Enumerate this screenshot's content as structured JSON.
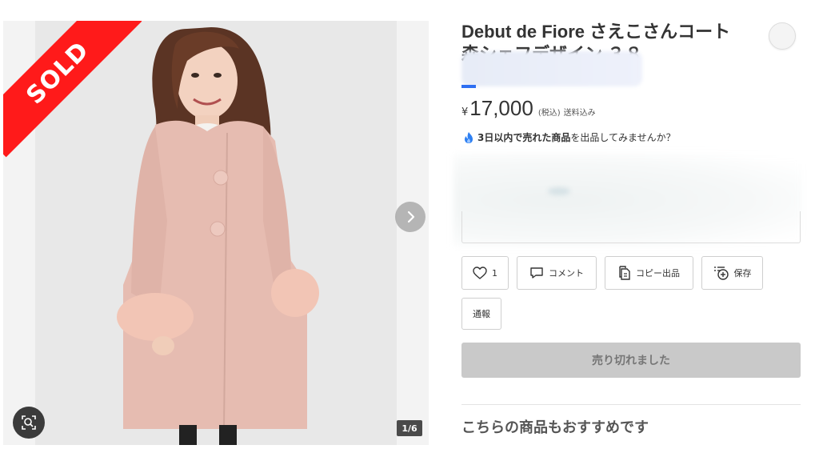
{
  "gallery": {
    "sold_label": "SOLD",
    "counter": "1/6",
    "next_icon": "chevron-right-icon",
    "zoom_icon": "zoom-search-icon"
  },
  "product": {
    "title_line1": "Debut de Fiore さえこさんコート",
    "title_line2": "森シェフデザイン ３８",
    "price_symbol": "¥",
    "price": "17,000",
    "tax_note": "(税込)",
    "shipping_note": "送料込み"
  },
  "promo": {
    "icon": "fire-icon",
    "bold_text": "3日以内で売れた商品",
    "rest_text": "を出品してみませんか？"
  },
  "actions": {
    "like_count": "1",
    "comment_label": "コメント",
    "copy_label": "コピー出品",
    "save_label": "保存",
    "report_label": "通報"
  },
  "status": {
    "sold_out_label": "売り切れました"
  },
  "recommend": {
    "heading": "こちらの商品もおすすめです"
  },
  "colors": {
    "sold_red": "#ff1a1a",
    "sold_out_gray": "#c9c9c9",
    "accent_blue": "#2e6ff2"
  }
}
